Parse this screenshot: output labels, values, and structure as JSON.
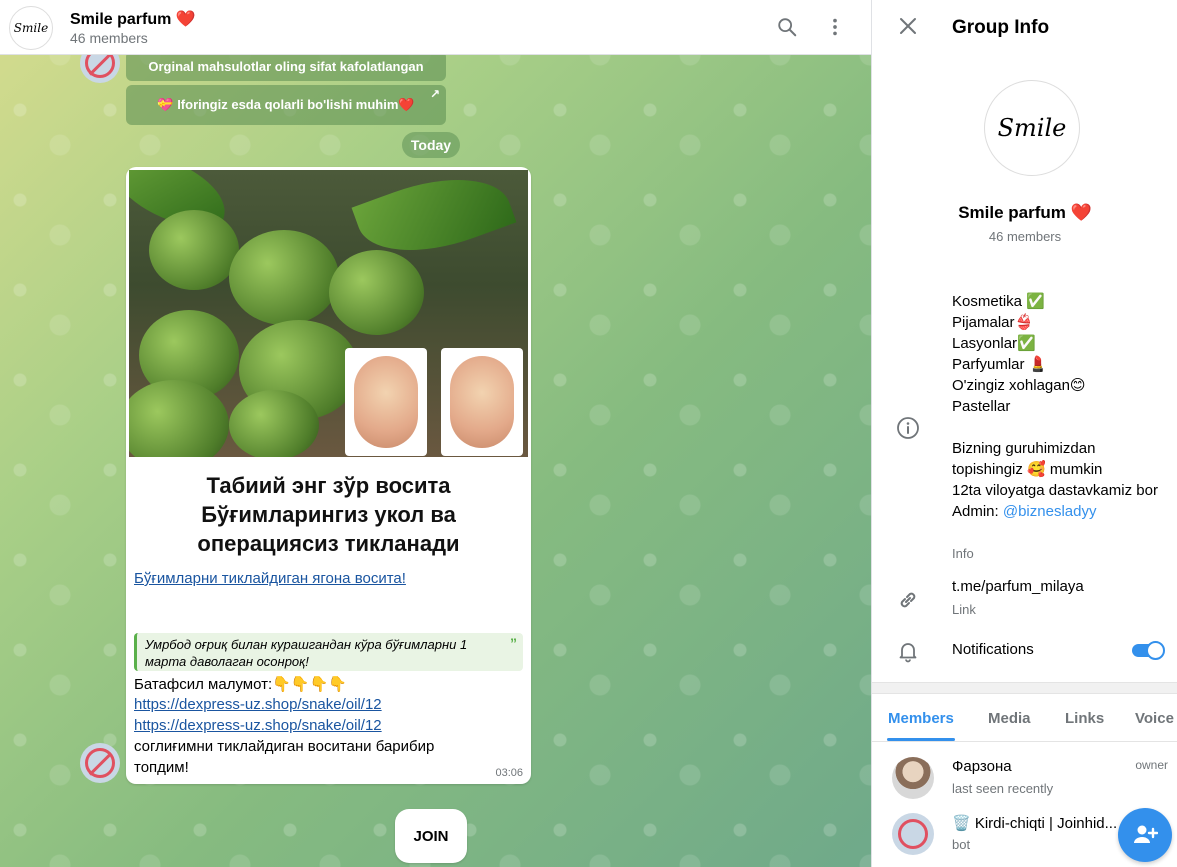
{
  "chat": {
    "title": "Smile parfum ❤️",
    "members": "46 members",
    "avatar_text": "Smile"
  },
  "pinned_lines": [
    "Orginal mahsulotlar oling sifat kafolatlangan",
    "💝 Iforingiz esda qolarli bo'lishi muhim❤️"
  ],
  "date_separator": "Today",
  "message": {
    "headline_1": "Табиий энг зўр восита",
    "headline_2": "Бўғимларингиз укол ва",
    "headline_3": "операциясиз тикланади",
    "link_text": "Бўғимларни тиклайдиган ягона восита!",
    "quote": "Умрбод оғриқ билан курашгандан кўра бўғимларни 1 марта даволаган осонроқ!",
    "details": "Батафсил малумот:👇👇👇👇",
    "url_1": "https://dexpress-uz.shop/snake/oil/12",
    "url_2": "https://dexpress-uz.shop/snake/oil/12",
    "closing_1": "соглиғимни тиклайдиган воситани барибир",
    "closing_2": "топдим!",
    "time": "03:06"
  },
  "join_label": "JOIN",
  "info_panel": {
    "title": "Group Info",
    "avatar_text": "Smile",
    "name": "Smile parfum ❤️",
    "members": "46 members",
    "description": "Kosmetika ✅\nPijamalar👙\nLasyonlar✅\nParfyumlar 💄\nO'zingiz xohlagan😊\nPastellar\n\nBizning guruhimizdan topishingiz 🥰 mumkin\n12ta viloyatga dastavkamiz bor\nAdmin: ",
    "admin_handle": "@biznesladyy",
    "info_label": "Info",
    "link_value": "t.me/parfum_milaya",
    "link_label": "Link",
    "notifications_label": "Notifications",
    "notifications_on": true
  },
  "tabs": [
    "Members",
    "Media",
    "Links",
    "Voice"
  ],
  "members": [
    {
      "name": "Фарзона",
      "status": "last seen recently",
      "role": "owner"
    },
    {
      "name": "🗑️ Kirdi-chiqti | Joinhid...",
      "status": "bot",
      "role": ""
    }
  ],
  "colors": {
    "accent": "#3390ec",
    "link": "#1a55a0",
    "quote_bar": "#5ab04a"
  }
}
